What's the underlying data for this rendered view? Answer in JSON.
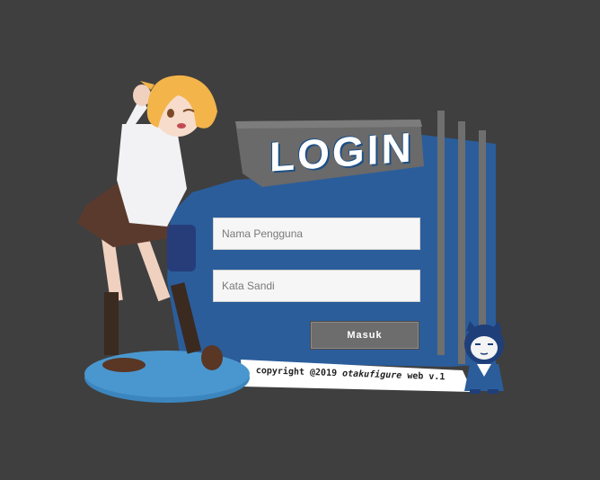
{
  "login": {
    "title": "LOGIN",
    "username_placeholder": "Nama Pengguna",
    "password_placeholder": "Kata Sandi",
    "submit_label": "Masuk"
  },
  "footer": {
    "copyright_prefix": "copyright @2019 ",
    "copyright_brand": "otakufigure",
    "copyright_suffix": " web v.1"
  },
  "colors": {
    "background": "#3f3f3f",
    "panel_blue": "#2b5d9b",
    "banner_gray": "#6a6a6a",
    "button_gray": "#6d6d6d"
  }
}
